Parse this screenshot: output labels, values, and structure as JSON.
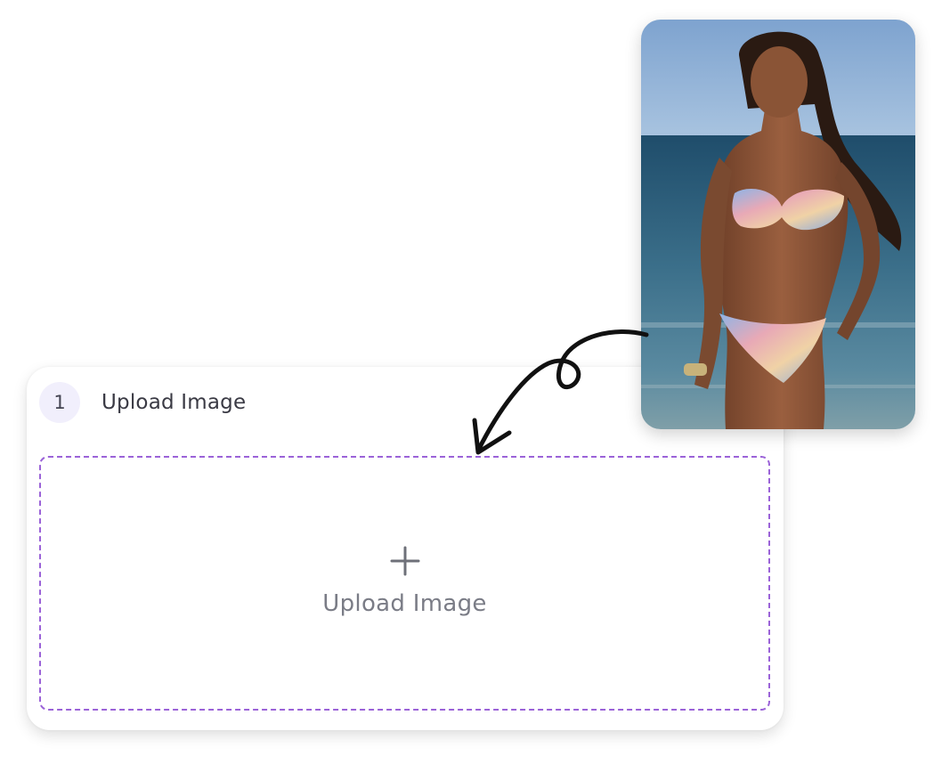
{
  "step": {
    "number": "1",
    "title": "Upload Image"
  },
  "dropzone": {
    "icon": "plus-icon",
    "label": "Upload Image",
    "border_color": "#9b63d8"
  },
  "example_photo": {
    "icon": "example-photo"
  },
  "colors": {
    "accent": "#9b63d8",
    "badge_bg": "#f1effc",
    "text_primary": "#3a3a44",
    "text_muted": "#7a7c86"
  }
}
